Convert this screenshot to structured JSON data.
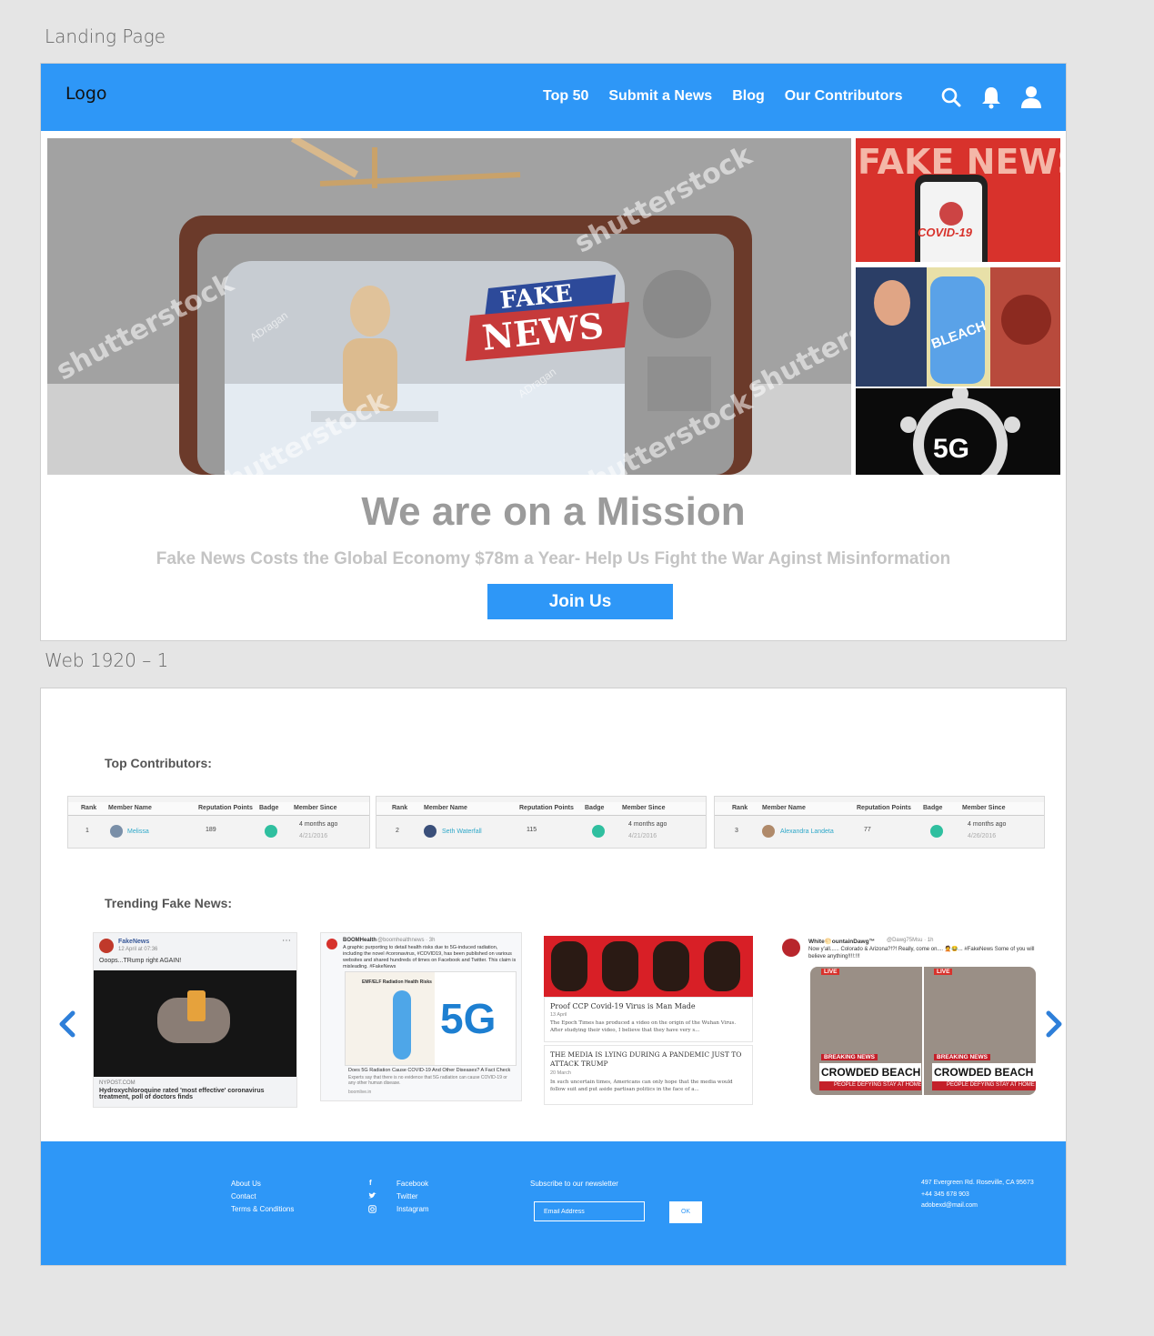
{
  "artboards": {
    "landing_label": "Landing Page",
    "web_label": "Web 1920 – 1"
  },
  "nav": {
    "logo": "Logo",
    "links": [
      "Top 50",
      "Submit a News",
      "Blog",
      "Our Contributors"
    ],
    "icons": [
      "search-icon",
      "bell-icon",
      "user-icon"
    ]
  },
  "hero": {
    "main_image_text": [
      "FAKE",
      "NEWS"
    ],
    "watermark": "shutterstock",
    "watermark_credit": "ADragan",
    "thumb1_text": [
      "FAKE NEWS",
      "COVID-19"
    ],
    "thumb2_text": "BLEACH",
    "thumb3_text": "5G"
  },
  "mission": {
    "title": "We are on a Mission",
    "subtitle": "Fake News Costs the Global Economy $78m a Year- Help Us Fight the War Aginst Misinformation",
    "join_label": "Join Us"
  },
  "contributors": {
    "heading": "Top Contributors:",
    "columns": [
      "Rank",
      "Member Name",
      "Reputation Points",
      "Badge",
      "Member Since"
    ],
    "rows": [
      {
        "rank": "1",
        "name": "Melissa",
        "points": "189",
        "since": "4 months ago",
        "date": "4/21/2016"
      },
      {
        "rank": "2",
        "name": "Seth Waterfall",
        "points": "115",
        "since": "4 months ago",
        "date": "4/21/2016"
      },
      {
        "rank": "3",
        "name": "Alexandra Landeta",
        "points": "77",
        "since": "4 months ago",
        "date": "4/26/2016"
      }
    ]
  },
  "trending": {
    "heading": "Trending Fake News:",
    "card1": {
      "account": "FakeNews",
      "date": "12 April at 07:36",
      "text": "Ooops...TRump right AGAIN!",
      "source": "NYPOST.COM",
      "headline": "Hydroxychloroquine rated 'most effective' coronavirus treatment, poll of doctors finds"
    },
    "card2": {
      "account": "BOOMHealth",
      "handle": "@boomhealthnews · 3h",
      "text": "A graphic purporting to detail health risks due to 5G-induced radiation, including the novel #coronavirus, #COVID19, has been published on various websites and shared hundreds of times on Facebook and Twitter. This claim is misleading. #FakeNews",
      "panel_title": "EMF/ELF Radiation Health Risks",
      "image_text": "5G",
      "link_title": "Does 5G Radiation Cause COVID-19 And Other Diseases? A Fact Check",
      "link_desc": "Experts say that there is no evidence that 5G radiation can cause COVID-19 or any other human disease.",
      "link_url": "boomlive.in"
    },
    "card3": {
      "title1": "Proof CCP Covid-19 Virus is Man Made",
      "date1": "13 April",
      "desc1": "The Epoch Times has produced a video on the origin of the Wuhan Virus. After studying their video, I believe that they have very s...",
      "title2": "THE MEDIA IS LYING DURING A PANDEMIC JUST TO ATTACK TRUMP",
      "date2": "20 March",
      "desc2": "In such uncertain times, Americans can only hope that the media would follow suit and put aside partisan politics in the face of a..."
    },
    "card4": {
      "account": "White🌕ountainDawg™",
      "handle": "@Dawg75Msu · 1h",
      "text": "Now y'all...... Colorado & Arizona?!?! Really, come on.... 🤦😂... #FakeNews Some of you will believe anything!!!!:!!!",
      "live": "LIVE",
      "breaking": "BREAKING NEWS",
      "headline": "CROWDED BEACH",
      "ticker": "PEOPLE DEFYING STAY AT HOME"
    }
  },
  "footer": {
    "links": [
      "About Us",
      "Contact",
      "Terms & Conditions"
    ],
    "social": [
      "Facebook",
      "Twitter",
      "Instagram"
    ],
    "newsletter_label": "Subscribe to our newsletter",
    "email_placeholder": "Email Address",
    "ok_label": "OK",
    "address": "497 Evergreen Rd. Roseville, CA 95673",
    "phone": "+44 345 678 903",
    "email": "adobexd@mail.com"
  },
  "colors": {
    "brand_blue": "#2e97f7",
    "badge_green": "#2fbf9f",
    "mission_gray": "#9b9b9b"
  }
}
